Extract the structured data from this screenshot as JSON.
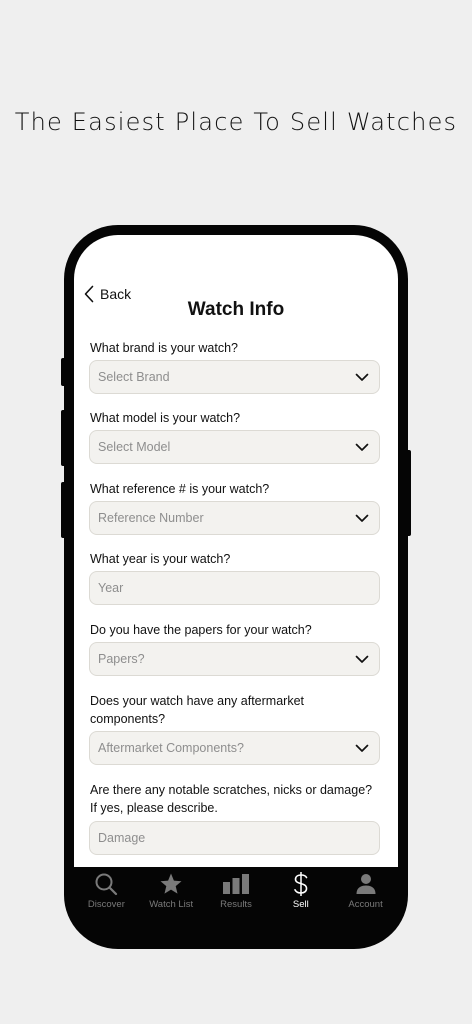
{
  "headline": "The Easiest Place To Sell Watches",
  "header": {
    "back_label": "Back",
    "title": "Watch Info"
  },
  "form": {
    "brand": {
      "label": "What brand is your watch?",
      "placeholder": "Select Brand"
    },
    "model": {
      "label": "What model is your watch?",
      "placeholder": "Select Model"
    },
    "reference": {
      "label": "What reference # is your watch?",
      "placeholder": "Reference Number"
    },
    "year": {
      "label": "What year is your watch?",
      "placeholder": "Year"
    },
    "papers": {
      "label": "Do you have the papers for your watch?",
      "placeholder": "Papers?"
    },
    "aftermarket": {
      "label_line1": "Does your watch have any aftermarket",
      "label_line2": "components?",
      "placeholder": "Aftermarket Components?"
    },
    "damage": {
      "label_line1": "Are there any notable scratches, nicks or damage?",
      "label_line2": "If yes, please describe.",
      "placeholder": "Damage"
    }
  },
  "tabs": [
    {
      "label": "Discover",
      "icon": "search-icon"
    },
    {
      "label": "Watch List",
      "icon": "star-icon"
    },
    {
      "label": "Results",
      "icon": "bar-chart-icon"
    },
    {
      "label": "Sell",
      "icon": "dollar-icon",
      "active": true
    },
    {
      "label": "Account",
      "icon": "person-icon"
    }
  ],
  "colors": {
    "background": "#efefef",
    "phone_frame": "#050505",
    "field_bg": "#f3f2ef",
    "inactive_tab": "#7a7a7a",
    "active_tab": "#ffffff"
  }
}
